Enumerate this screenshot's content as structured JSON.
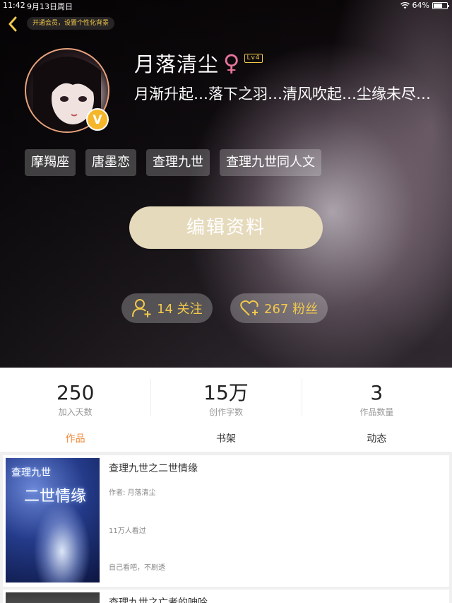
{
  "status_bar": {
    "time": "11:42",
    "date": "9月13日周日",
    "battery": "64%"
  },
  "header": {
    "vip_prompt": "开通会员，设置个性化背景"
  },
  "profile": {
    "nickname": "月落清尘",
    "gender_symbol": "♀",
    "level": "Lv4",
    "vip_badge": "V",
    "bio": "月渐升起…落下之羽…清风吹起…尘缘未尽…",
    "tags": [
      "摩羯座",
      "唐墨恋",
      "查理九世",
      "查理九世同人文"
    ],
    "edit_button": "编辑资料",
    "following": "14 关注",
    "fans": "267 粉丝"
  },
  "stats": [
    {
      "value": "250",
      "label": "加入天数"
    },
    {
      "value": "15万",
      "label": "创作字数"
    },
    {
      "value": "3",
      "label": "作品数量"
    }
  ],
  "tabs": [
    {
      "label": "作品",
      "active": true
    },
    {
      "label": "书架",
      "active": false
    },
    {
      "label": "动态",
      "active": false
    }
  ],
  "works": [
    {
      "title": "查理九世之二世情缘",
      "author": "作者: 月落清尘",
      "reads": "11万人看过",
      "desc": "自己看吧，不剧透",
      "cover_text_top": "查理九世",
      "cover_text_main": "二世情缘"
    },
    {
      "title": "查理九世之亡者的呻吟"
    }
  ],
  "colors": {
    "accent": "#f08a3a",
    "gold": "#f2c94c",
    "edit_button": "#e6dabd",
    "female": "#e8759a"
  }
}
